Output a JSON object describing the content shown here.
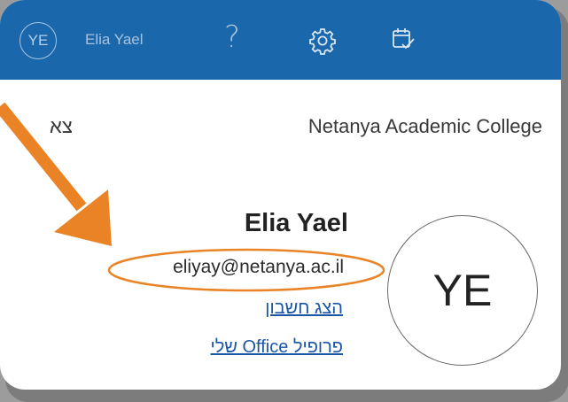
{
  "topbar": {
    "avatar_initials": "YE",
    "user_name": "Elia Yael",
    "help_glyph": "?",
    "icons": [
      "gear-icon",
      "calendar-check-icon"
    ],
    "color": "#1a67ab"
  },
  "account": {
    "organization": "Netanya Academic College",
    "sign_out": "צא",
    "display_name": "Elia Yael",
    "email": "eliyay@netanya.ac.il",
    "view_account": "הצג חשבון",
    "office_profile": "פרופיל Office שלי",
    "avatar_initials": "YE"
  },
  "annotations": {
    "arrow_color": "#e98326",
    "highlight": "email-oval"
  }
}
